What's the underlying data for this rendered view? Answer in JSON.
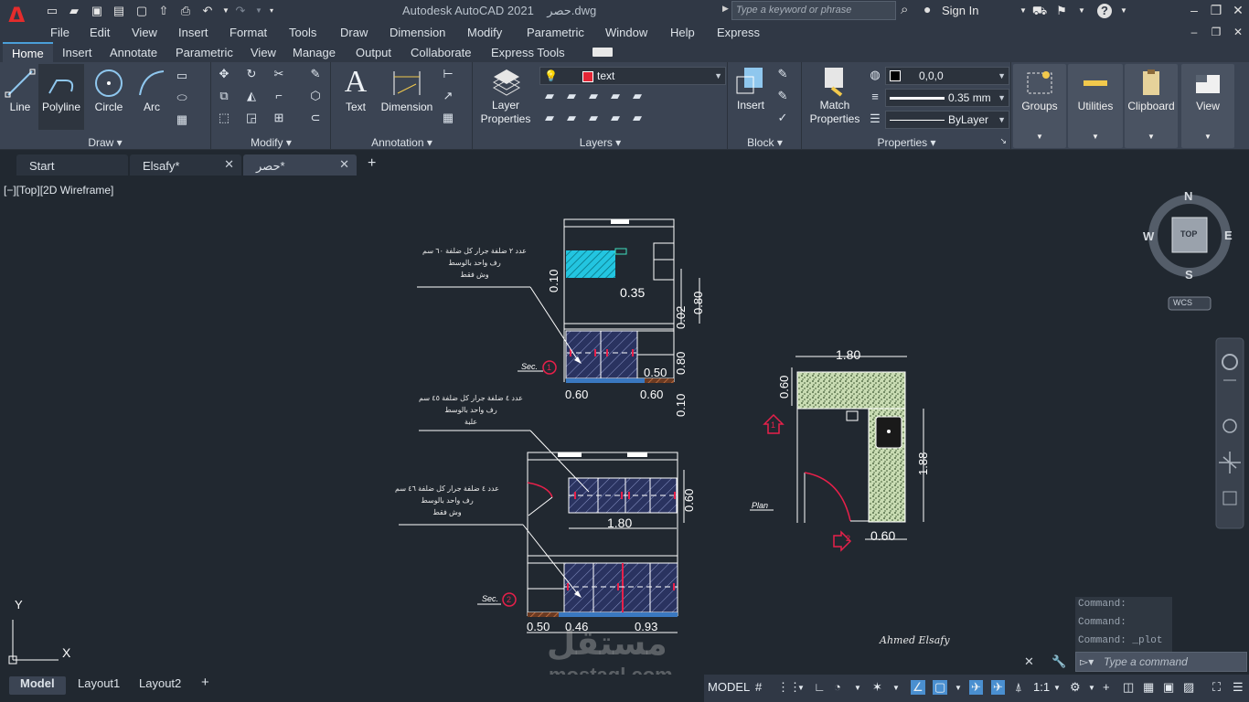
{
  "app": {
    "title": "Autodesk AutoCAD 2021",
    "filename": "حصر.dwg",
    "logo_letter": "A",
    "search_placeholder": "Type a keyword or phrase",
    "signin": "Sign In",
    "help": "?"
  },
  "menu": [
    "File",
    "Edit",
    "View",
    "Insert",
    "Format",
    "Tools",
    "Draw",
    "Dimension",
    "Modify",
    "Parametric",
    "Window",
    "Help",
    "Express"
  ],
  "ribbon_tabs": [
    "Home",
    "Insert",
    "Annotate",
    "Parametric",
    "View",
    "Manage",
    "Output",
    "Collaborate",
    "Express Tools"
  ],
  "ribbon": {
    "draw": {
      "title": "Draw",
      "line": "Line",
      "polyline": "Polyline",
      "circle": "Circle",
      "arc": "Arc"
    },
    "modify": {
      "title": "Modify"
    },
    "annotation": {
      "title": "Annotation",
      "text": "Text",
      "dimension": "Dimension"
    },
    "layers": {
      "title": "Layers",
      "layer_properties_1": "Layer",
      "layer_properties_2": "Properties",
      "current_layer": "text"
    },
    "block": {
      "title": "Block",
      "insert": "Insert"
    },
    "properties": {
      "title": "Properties",
      "match_1": "Match",
      "match_2": "Properties",
      "color": "0,0,0",
      "lineweight": "0.35 mm",
      "linetype": "ByLayer"
    },
    "groups": "Groups",
    "utilities": "Utilities",
    "clipboard": "Clipboard",
    "view": "View"
  },
  "file_tabs": [
    {
      "label": "Start"
    },
    {
      "label": "Elsafy*"
    },
    {
      "label": "حصر*"
    }
  ],
  "viewport_label": "[−][Top][2D Wireframe]",
  "viewcube": {
    "n": "N",
    "s": "S",
    "e": "E",
    "w": "W",
    "face": "TOP",
    "wcs": "WCS"
  },
  "drawing": {
    "note1_line1": "عدد ٢ ضلفة جرار كل ضلفة ٦٠ سم",
    "note1_line2": "رف واحد بالوسط",
    "note1_line3": "وش فقط",
    "note2_line1": "عدد ٤ ضلفة جرار كل ضلفة ٤٥ سم",
    "note2_line2": "رف واحد بالوسط",
    "note2_line3": "علبة",
    "note3_line1": "عدد ٤ ضلفة جرار كل ضلفة ٤٦ سم",
    "note3_line2": "رف واحد بالوسط",
    "note3_line3": "وش فقط",
    "sec1": "Sec.",
    "sec1_num": "1",
    "sec2": "Sec.",
    "sec2_num": "2",
    "plan": "Plan",
    "plan_marker1": "1",
    "plan_marker2": "2",
    "dim_035": "0.35",
    "dim_010a": "0.10",
    "dim_002": "0.02",
    "dim_080a": "0.80",
    "dim_080b": "0.80",
    "dim_010b": "0.10",
    "dim_050a": "0.50",
    "dim_060a": "0.60",
    "dim_060b": "0.60",
    "dim_060c": "0.60",
    "dim_180a": "1.80",
    "dim_050b": "0.50",
    "dim_046": "0.46",
    "dim_093": "0.93",
    "dim_180b": "1.80",
    "dim_060d": "0.60",
    "dim_188": "1.88",
    "dim_060e": "0.60",
    "signature": "Ahmed Elsafy",
    "ucs_x": "X",
    "ucs_y": "Y"
  },
  "command": {
    "history": [
      "Command:",
      "Command:",
      "Command: _plot"
    ],
    "placeholder": "Type a command"
  },
  "layout_tabs": [
    "Model",
    "Layout1",
    "Layout2"
  ],
  "status": {
    "model": "MODEL",
    "scale": "1:1"
  },
  "watermark": {
    "main": "مستقل",
    "sub": "mostaql.com"
  }
}
